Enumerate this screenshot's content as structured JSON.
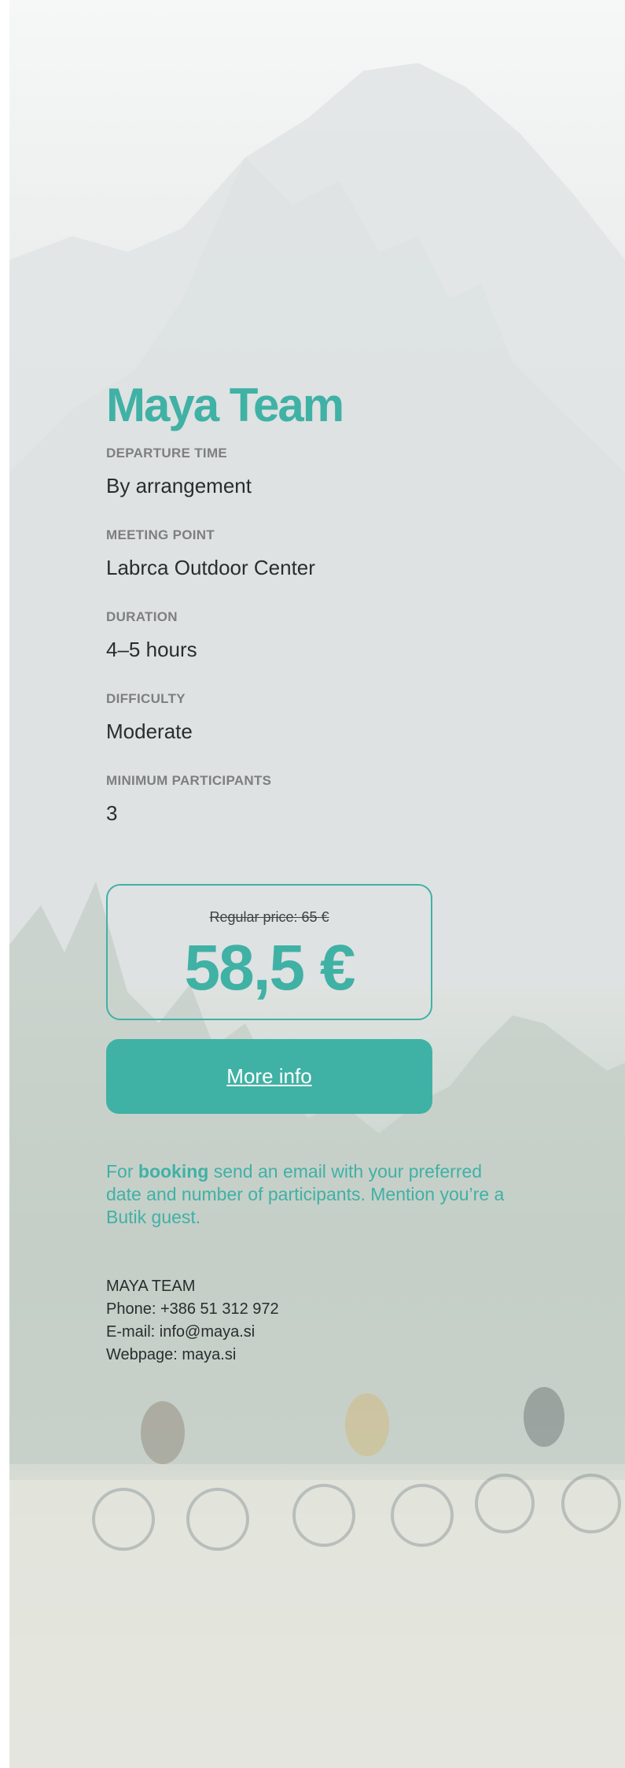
{
  "title": "Maya Team",
  "fields": [
    {
      "label": "DEPARTURE TIME",
      "value": "By arrangement"
    },
    {
      "label": "MEETING POINT",
      "value": "Labrca Outdoor Center"
    },
    {
      "label": "DURATION",
      "value": "4–5 hours"
    },
    {
      "label": "DIFFICULTY",
      "value": "Moderate"
    },
    {
      "label": "MINIMUM PARTICIPANTS",
      "value": "3"
    }
  ],
  "price": {
    "regular": "Regular price: 65 €",
    "discounted": "58,5 €"
  },
  "more_info_label": "More info",
  "booking": {
    "prefix": "For ",
    "bold": "booking",
    "suffix": " send an email with your preferred date and number of participants. Mention you’re a Butik guest."
  },
  "contact": {
    "name": "MAYA TEAM",
    "phone": "Phone:  +386 51 312 972",
    "email": "E-mail:  info@maya.si",
    "web": "Webpage: maya.si"
  },
  "colors": {
    "accent": "#40b1a5",
    "text": "#2a2d2e",
    "label": "#7d7f80"
  }
}
